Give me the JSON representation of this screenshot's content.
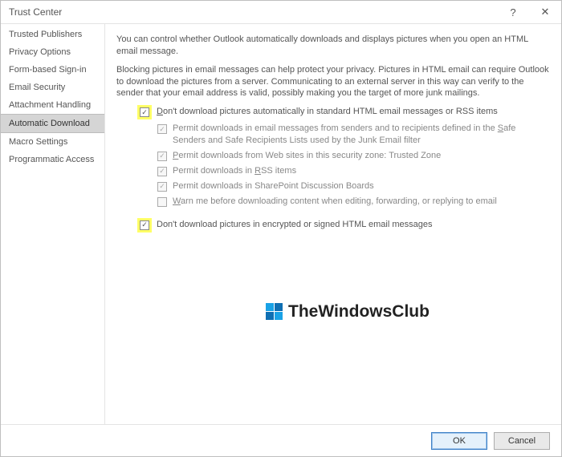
{
  "titlebar": {
    "title": "Trust Center",
    "help": "?",
    "close": "✕"
  },
  "sidebar": {
    "items": [
      {
        "label": "Trusted Publishers"
      },
      {
        "label": "Privacy Options"
      },
      {
        "label": "Form-based Sign-in"
      },
      {
        "label": "Email Security"
      },
      {
        "label": "Attachment Handling"
      },
      {
        "label": "Automatic Download",
        "selected": true
      },
      {
        "label": "Macro Settings"
      },
      {
        "label": "Programmatic Access"
      }
    ]
  },
  "content": {
    "intro1": "You can control whether Outlook automatically downloads and displays pictures when you open an HTML email message.",
    "intro2": "Blocking pictures in email messages can help protect your privacy. Pictures in HTML email can require Outlook to download the pictures from a server. Communicating to an external server in this way can verify to the sender that your email address is valid, possibly making you the target of more junk mailings.",
    "opt_main": {
      "checked": true,
      "text_pre": "D",
      "text_post": "on't download pictures automatically in standard HTML email messages or RSS items",
      "highlight": true
    },
    "opt_safe": {
      "checked": true,
      "text": "Permit downloads in email messages from senders and to recipients defined in the ",
      "u": "S",
      "text2": "afe Senders and Safe Recipients Lists used by the Junk Email filter"
    },
    "opt_zone": {
      "checked": true,
      "u": "P",
      "text": "ermit downloads from Web sites in this security zone: Trusted Zone"
    },
    "opt_rss": {
      "checked": true,
      "text": "Permit downloads in ",
      "u": "R",
      "text2": "SS items"
    },
    "opt_sp": {
      "checked": true,
      "text": "Permit downloads in SharePoint Discussion Boards"
    },
    "opt_warn": {
      "checked": false,
      "u": "W",
      "text": "arn me before downloading content when editing, forwarding, or replying to email"
    },
    "opt_enc": {
      "checked": true,
      "text": "Don't download pictures in encrypted or signed HTML email messages",
      "highlight": true
    }
  },
  "watermark": {
    "text": "TheWindowsClub"
  },
  "buttons": {
    "ok": "OK",
    "cancel": "Cancel"
  }
}
